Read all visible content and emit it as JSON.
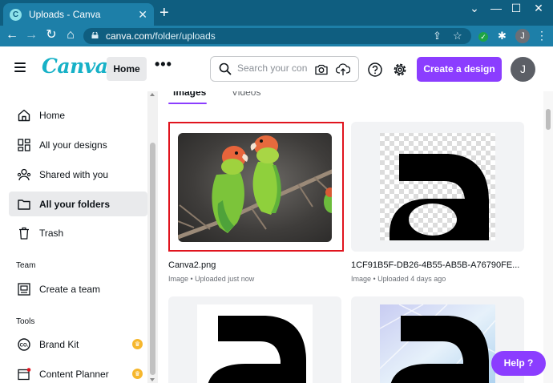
{
  "browser": {
    "tab_title": "Uploads - Canva",
    "tab_favicon": "C",
    "url_host": "canva.com",
    "url_path": "/folder/uploads",
    "profile_initial": "J"
  },
  "header": {
    "logo": "Canva",
    "home_label": "Home",
    "search_placeholder": "Search your con",
    "create_label": "Create a design",
    "avatar_initial": "J",
    "brand_color": "#8b3dff",
    "logo_color": "#17b1c7"
  },
  "sidebar": {
    "items": [
      {
        "label": "Home",
        "icon": "home-icon"
      },
      {
        "label": "All your designs",
        "icon": "grid-icon"
      },
      {
        "label": "Shared with you",
        "icon": "people-icon"
      },
      {
        "label": "All your folders",
        "icon": "folder-icon",
        "active": true
      },
      {
        "label": "Trash",
        "icon": "trash-icon"
      }
    ],
    "team_heading": "Team",
    "team_items": [
      {
        "label": "Create a team",
        "icon": "team-icon"
      }
    ],
    "tools_heading": "Tools",
    "tools_items": [
      {
        "label": "Brand Kit",
        "icon": "brand-kit-icon",
        "premium": true
      },
      {
        "label": "Content Planner",
        "icon": "calendar-icon",
        "premium": true
      }
    ]
  },
  "main": {
    "tabs": [
      {
        "label": "Images",
        "selected": true
      },
      {
        "label": "Videos",
        "selected": false
      }
    ],
    "cards": [
      {
        "name": "Canva2.png",
        "meta": "Image • Uploaded just now",
        "selected": true
      },
      {
        "name": "1CF91B5F-DB26-4B55-AB5B-A76790FE...",
        "meta": "Image • Uploaded 4 days ago"
      },
      {
        "name": "",
        "meta": ""
      },
      {
        "name": "",
        "meta": ""
      }
    ]
  },
  "help_label": "Help ?"
}
